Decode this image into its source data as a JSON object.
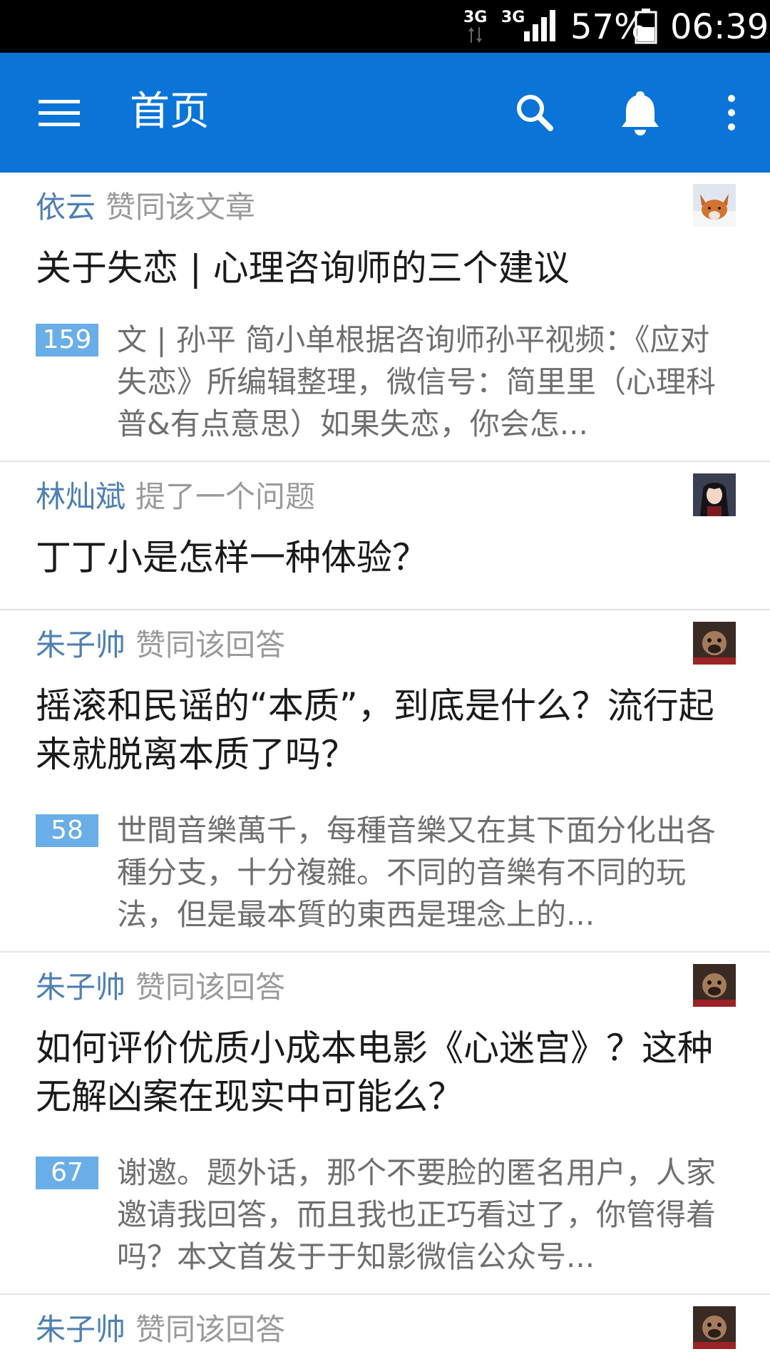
{
  "status_bar": {
    "network_1": "3G",
    "network_2": "3G",
    "battery_percent": "57%",
    "time": "06:39"
  },
  "app_bar": {
    "title": "首页",
    "icons": [
      "menu-icon",
      "search-icon",
      "bell-icon",
      "more-vert-icon"
    ],
    "background_color": "#0a74d8"
  },
  "feed": [
    {
      "user": "依云",
      "action": "赞同该文章",
      "title": "关于失恋 | 心理咨询师的三个建议",
      "votes": "159",
      "excerpt": "文 | 孙平 简小单根据咨询师孙平视频：《应对失恋》所编辑整理，微信号：简里里（心理科普&有点意思）如果失恋，你会怎..."
    },
    {
      "user": "林灿斌",
      "action": "提了一个问题",
      "title": "丁丁小是怎样一种体验？"
    },
    {
      "user": "朱子帅",
      "action": "赞同该回答",
      "title": "摇滚和民谣的“本质”，到底是什么？流行起来就脱离本质了吗？",
      "votes": "58",
      "excerpt": "世間音樂萬千，每種音樂又在其下面分化出各種分支，十分複雜。不同的音樂有不同的玩法，但是最本質的東西是理念上的..."
    },
    {
      "user": "朱子帅",
      "action": "赞同该回答",
      "title": "如何评价优质小成本电影《心迷宫》？这种无解凶案在现实中可能么？",
      "votes": "67",
      "excerpt": "谢邀。题外话，那个不要脸的匿名用户，人家邀请我回答，而且我也正巧看过了，你管得着吗？本文首发于于知影微信公众号..."
    },
    {
      "user": "朱子帅",
      "action": "赞同该回答"
    }
  ],
  "colors": {
    "user_name": "#4d7fb4",
    "action_text": "#9a9a9a",
    "vote_badge": "#6aaee7"
  }
}
